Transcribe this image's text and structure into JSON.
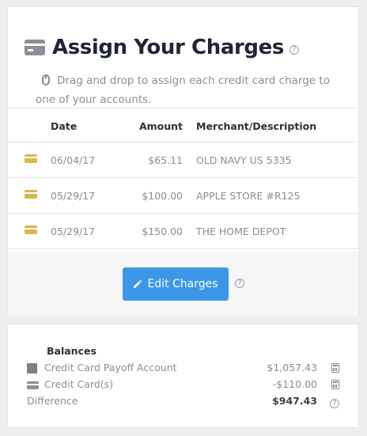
{
  "header": {
    "title": "Assign Your Charges",
    "help_glyph": "?",
    "instructions": "Drag and drop to assign each credit card charge to one of your accounts."
  },
  "table": {
    "columns": {
      "date": "Date",
      "amount": "Amount",
      "merchant": "Merchant/Description"
    },
    "rows": [
      {
        "date": "06/04/17",
        "amount": "$65.11",
        "merchant": "OLD NAVY US 5335"
      },
      {
        "date": "05/29/17",
        "amount": "$100.00",
        "merchant": "APPLE STORE #R125"
      },
      {
        "date": "05/29/17",
        "amount": "$150.00",
        "merchant": "THE HOME DEPOT"
      }
    ]
  },
  "actions": {
    "edit_label": "Edit Charges"
  },
  "balances": {
    "title": "Balances",
    "rows": [
      {
        "label": "Credit Card Payoff Account",
        "value": "$1,057.43",
        "icon": "square-icon",
        "tail": "calculator-icon"
      },
      {
        "label": "Credit Card(s)",
        "value": "-$110.00",
        "icon": "credit-card-icon",
        "tail": "calculator-icon"
      },
      {
        "label": "Difference",
        "value": "$947.43",
        "icon": "",
        "tail": "help-icon"
      }
    ]
  },
  "colors": {
    "accent": "#3d97e8",
    "charge_icon": "#d8b84a",
    "title_text": "#1f2532",
    "muted_text": "#8a8d93"
  }
}
